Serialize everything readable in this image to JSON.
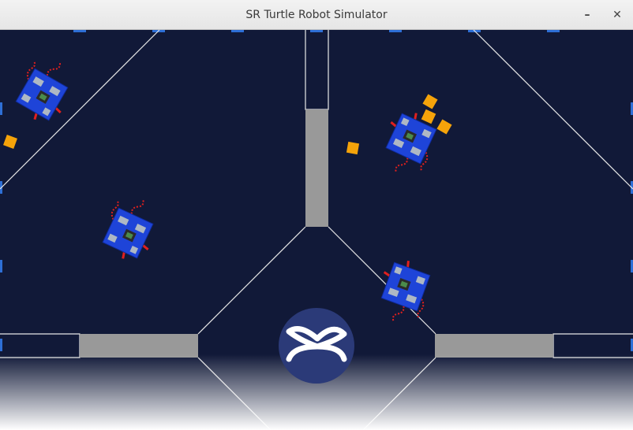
{
  "window": {
    "title": "SR Turtle Robot Simulator",
    "minimize_glyph": "–",
    "close_glyph": "✕"
  },
  "arena": {
    "background_color": "#111938",
    "line_color": "#e8e8e8",
    "wall_color": "#999999",
    "token_color": "#f5a30a",
    "marker_color": "#2e6fd6",
    "logo_color": "#2b3a78",
    "robot_count": 4,
    "token_count": 5,
    "logo": "sr-logo-icon"
  },
  "icons": {
    "minimize": "minimize-icon",
    "close": "close-icon",
    "robot": "robot-icon",
    "token": "token-icon"
  }
}
